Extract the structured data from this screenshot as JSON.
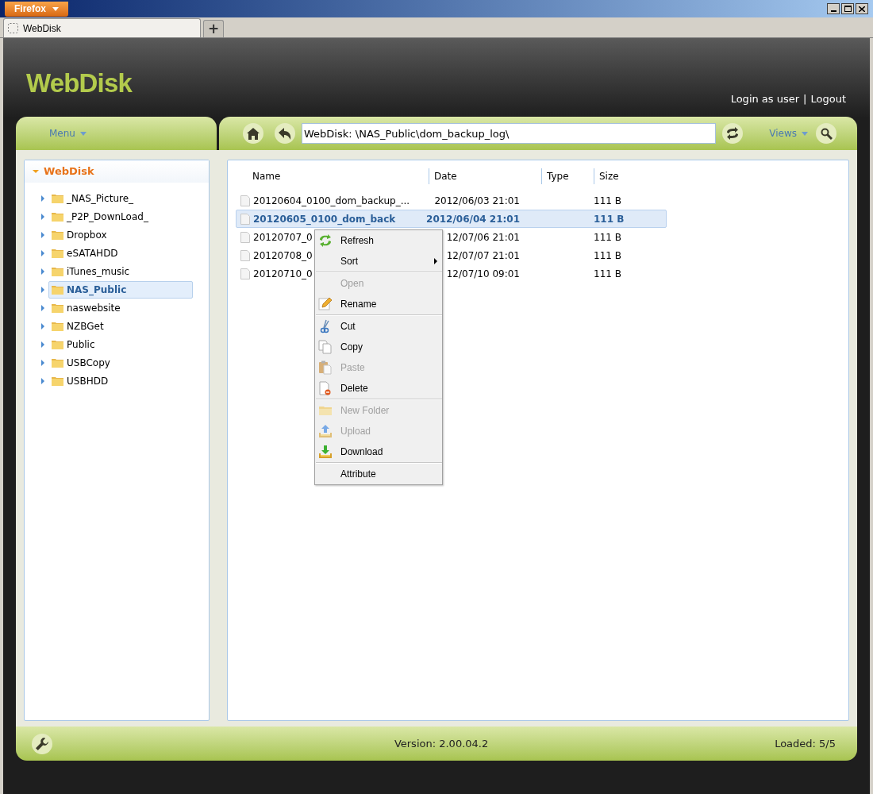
{
  "browser": {
    "app_button": "Firefox",
    "tabs": [
      {
        "label": "WebDisk",
        "selected": true
      }
    ],
    "new_tab": "+"
  },
  "header": {
    "logo": "WebDisk",
    "user_link": "Login as user",
    "separator": "|",
    "logout_link": "Logout"
  },
  "toolbar": {
    "menu_button": "Menu",
    "path": {
      "value": "WebDisk: \\NAS_Public\\dom_backup_log\\"
    },
    "views_button": "Views"
  },
  "tree": {
    "label": "WebDisk",
    "expanded": true,
    "children": [
      {
        "label": "_NAS_Picture_",
        "expanded": false,
        "selected": false
      },
      {
        "label": "_P2P_DownLoad_",
        "expanded": false,
        "selected": false
      },
      {
        "label": "Dropbox",
        "expanded": false,
        "selected": false
      },
      {
        "label": "eSATAHDD",
        "expanded": false,
        "selected": false
      },
      {
        "label": "iTunes_music",
        "expanded": false,
        "selected": false
      },
      {
        "label": "NAS_Public",
        "expanded": false,
        "selected": true
      },
      {
        "label": "naswebsite",
        "expanded": false,
        "selected": false
      },
      {
        "label": "NZBGet",
        "expanded": false,
        "selected": false
      },
      {
        "label": "Public",
        "expanded": false,
        "selected": false
      },
      {
        "label": "USBCopy",
        "expanded": false,
        "selected": false
      },
      {
        "label": "USBHDD",
        "expanded": false,
        "selected": false
      }
    ]
  },
  "table": {
    "columns": [
      "Name",
      "Date",
      "Type",
      "Size"
    ],
    "rows": [
      {
        "name": "20120604_0100_dom_backup_...",
        "date": "2012/06/03 21:01",
        "size": "111 B",
        "selected": false
      },
      {
        "name": "20120605_0100_dom_back",
        "date": "2012/06/04 21:01",
        "size": "111 B",
        "selected": true
      },
      {
        "name": "20120707_0",
        "date": "12/07/06 21:01",
        "size": "111 B",
        "selected": false
      },
      {
        "name": "20120708_0",
        "date": "12/07/07 21:01",
        "size": "111 B",
        "selected": false
      },
      {
        "name": "20120710_0",
        "date": "12/07/10 09:01",
        "size": "111 B",
        "selected": false
      }
    ]
  },
  "context_menu": {
    "groups": [
      [
        {
          "label": "Refresh",
          "disabled": false,
          "submenu": false
        },
        {
          "label": "Sort",
          "disabled": false,
          "submenu": true
        }
      ],
      [
        {
          "label": "Open",
          "disabled": true,
          "submenu": false
        },
        {
          "label": "Rename",
          "disabled": false,
          "submenu": false
        }
      ],
      [
        {
          "label": "Cut",
          "disabled": false,
          "submenu": false
        },
        {
          "label": "Copy",
          "disabled": false,
          "submenu": false
        },
        {
          "label": "Paste",
          "disabled": true,
          "submenu": false
        },
        {
          "label": "Delete",
          "disabled": false,
          "submenu": false
        }
      ],
      [
        {
          "label": "New Folder",
          "disabled": true,
          "submenu": false
        },
        {
          "label": "Upload",
          "disabled": true,
          "submenu": false
        },
        {
          "label": "Download",
          "disabled": false,
          "submenu": false
        }
      ],
      [
        {
          "label": "Attribute",
          "disabled": false,
          "submenu": false
        }
      ]
    ]
  },
  "status_bar": {
    "version": "Version: 2.00.04.2",
    "loaded": "Loaded: 5/5"
  }
}
